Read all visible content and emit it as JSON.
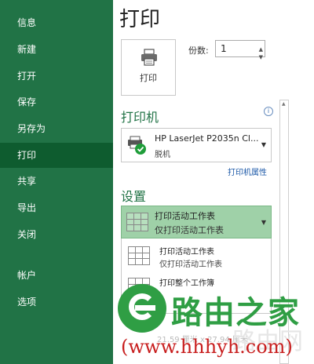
{
  "sidebar": {
    "items": [
      {
        "label": "信息"
      },
      {
        "label": "新建"
      },
      {
        "label": "打开"
      },
      {
        "label": "保存"
      },
      {
        "label": "另存为"
      },
      {
        "label": "打印",
        "active": true
      },
      {
        "label": "共享"
      },
      {
        "label": "导出"
      },
      {
        "label": "关闭"
      },
      {
        "label": "帐户"
      },
      {
        "label": "选项"
      }
    ]
  },
  "main": {
    "title": "打印",
    "print_button_label": "打印",
    "copies_label": "份数:",
    "copies_value": "1",
    "printer_section_title": "打印机",
    "printer_name": "HP LaserJet P2035n Cl...",
    "printer_status": "脱机",
    "printer_properties_link": "打印机属性",
    "settings_section_title": "设置",
    "settings_selected": {
      "title": "打印活动工作表",
      "subtitle": "仅打印活动工作表"
    },
    "dropdown_options": [
      {
        "title": "打印活动工作表",
        "subtitle": "仅打印活动工作表"
      },
      {
        "title": "打印整个工作簿",
        "subtitle": ""
      }
    ],
    "faded_text": "21.59 厘米 x 27.94 厘米"
  },
  "watermark": {
    "brand_text": "路由之家",
    "url_text": "(www.hhhyh.com)",
    "ghost_text": "路由网"
  },
  "colors": {
    "sidebar_bg": "#217346",
    "sidebar_active": "#0e5c2f",
    "accent": "#217346",
    "selection_bg": "#9fd1a8",
    "link": "#1e5aa8",
    "watermark_green": "#2f9e44",
    "watermark_red": "#c81e1e"
  },
  "icons": {
    "print_button": "printer-icon",
    "printer_select": "printer-offline-icon",
    "info": "info-icon",
    "sheet": "worksheet-icon",
    "dropdown": "chevron-down-icon"
  }
}
